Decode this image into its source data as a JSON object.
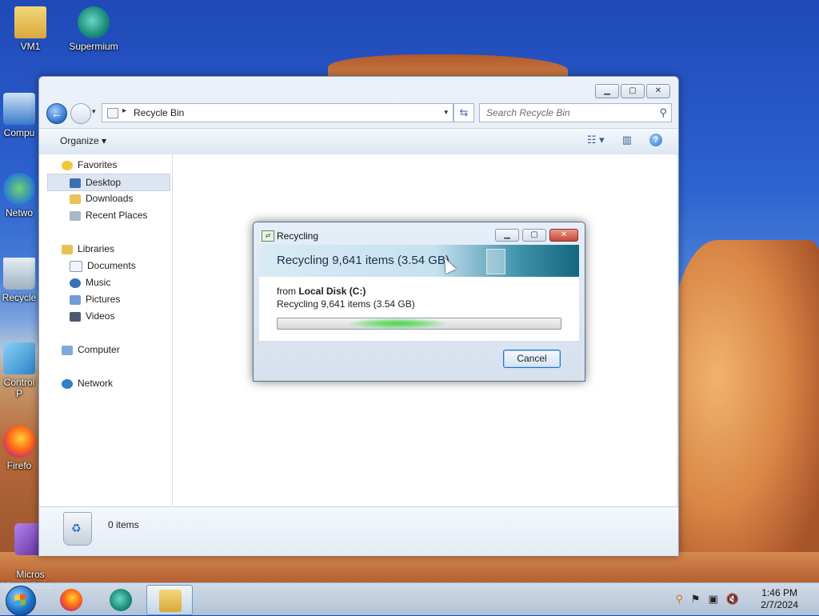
{
  "desktop": {
    "icons": [
      {
        "label": "VM1",
        "icon": "folder-user-icon"
      },
      {
        "label": "Supermium",
        "icon": "supermium-icon"
      },
      {
        "label": "Compu",
        "icon": "computer-icon"
      },
      {
        "label": "Netwo",
        "icon": "network-icon"
      },
      {
        "label": "Recycle",
        "icon": "recycle-bin-icon"
      },
      {
        "label": "Control P",
        "icon": "control-panel-icon"
      },
      {
        "label": "Firefo",
        "icon": "firefox-icon"
      },
      {
        "label": "Micros\nVisual Stud...",
        "icon": "visual-studio-icon"
      }
    ]
  },
  "explorer": {
    "window_controls": {
      "minimize": "▁",
      "maximize": "▢",
      "close": "✕"
    },
    "address": {
      "path": "Recycle Bin",
      "separator": "▸"
    },
    "search": {
      "placeholder": "Search Recycle Bin"
    },
    "toolbar": {
      "organize": "Organize ▾"
    },
    "nav": {
      "favorites": "Favorites",
      "desktop": "Desktop",
      "downloads": "Downloads",
      "recent_places": "Recent Places",
      "libraries": "Libraries",
      "documents": "Documents",
      "music": "Music",
      "pictures": "Pictures",
      "videos": "Videos",
      "computer": "Computer",
      "network": "Network"
    },
    "details": {
      "items": "0 items"
    }
  },
  "dialog": {
    "title": "Recycling",
    "heading": "Recycling 9,641 items (3.54 GB)",
    "from_prefix": "from",
    "from_location": "Local Disk (C:)",
    "detail": "Recycling 9,641 items (3.54 GB)",
    "cancel": "Cancel",
    "progress_state": "indeterminate"
  },
  "taskbar": {
    "apps": [
      "firefox-icon",
      "supermium-icon",
      "explorer-icon"
    ],
    "clock": {
      "time": "1:46 PM",
      "date": "2/7/2024"
    },
    "tray": [
      "search-icon",
      "flag-icon",
      "network-icon",
      "volume-muted-icon"
    ]
  },
  "colors": {
    "accent": "#2a6fc9",
    "progress": "#52d152"
  }
}
